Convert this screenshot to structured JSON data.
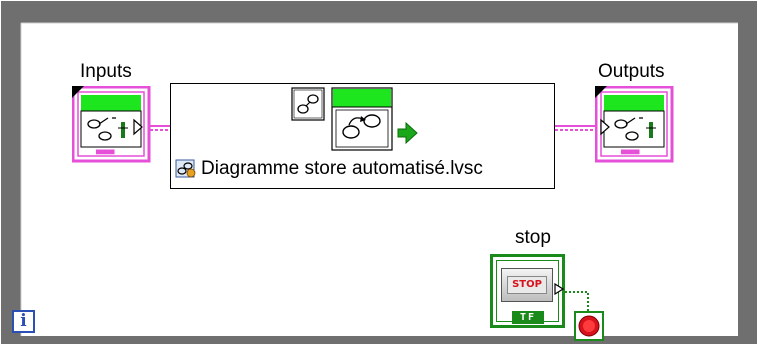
{
  "inputs": {
    "label": "Inputs"
  },
  "outputs": {
    "label": "Outputs"
  },
  "statechart": {
    "name": "Diagramme store automatisé.lvsc"
  },
  "stop_control": {
    "label": "stop",
    "button_text": "STOP",
    "type_label": "TF"
  },
  "iteration_terminal": {
    "text": "i"
  },
  "colors": {
    "loop_border": "#7a7a7a",
    "cluster_wire": "#e64fd8",
    "bool_wire": "#1a8a1a",
    "green_header": "#1ee61e",
    "stop_red": "#d8121c",
    "iteration_blue": "#2a4fb5"
  }
}
